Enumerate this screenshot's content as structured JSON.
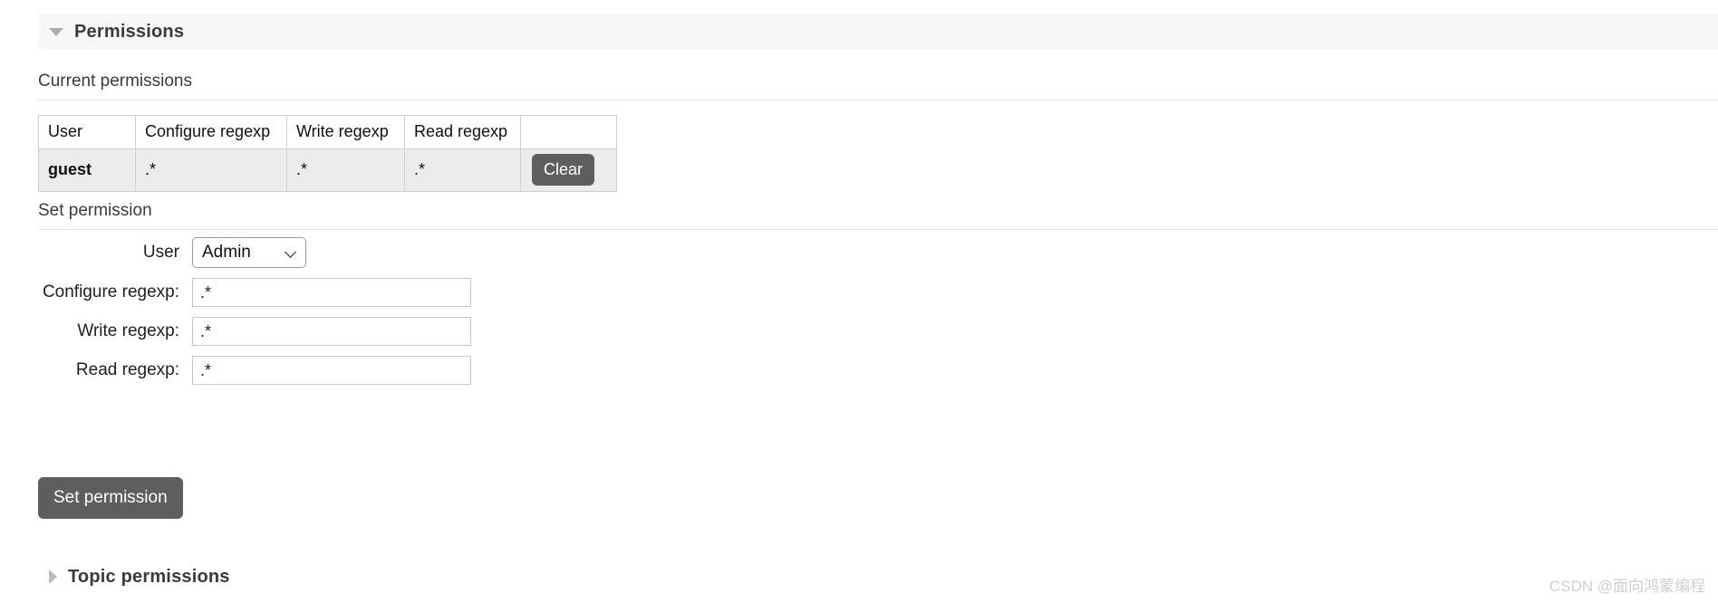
{
  "sections": {
    "permissions": {
      "title": "Permissions",
      "expanded": true,
      "toggle_icon": "triangle-down-icon"
    },
    "topic_permissions": {
      "title": "Topic permissions",
      "expanded": false,
      "toggle_icon": "triangle-right-icon"
    }
  },
  "current_permissions": {
    "heading": "Current permissions",
    "columns": [
      "User",
      "Configure regexp",
      "Write regexp",
      "Read regexp",
      ""
    ],
    "rows": [
      {
        "user": "guest",
        "configure": ".*",
        "write": ".*",
        "read": ".*",
        "action_label": "Clear"
      }
    ]
  },
  "set_permission": {
    "heading": "Set permission",
    "fields": {
      "user_label": "User",
      "user_value": "Admin",
      "user_options": [
        "Admin"
      ],
      "configure_label": "Configure regexp:",
      "configure_value": ".*",
      "write_label": "Write regexp:",
      "write_value": ".*",
      "read_label": "Read regexp:",
      "read_value": ".*"
    },
    "submit_label": "Set permission"
  },
  "colors": {
    "section_bar_bg": "#f7f7f7",
    "button_bg": "#5e5e5e",
    "button_text": "#ffffff",
    "table_row_bg": "#ececec",
    "border": "#cfcfcf"
  },
  "watermark": "CSDN @面向鸿蒙编程"
}
